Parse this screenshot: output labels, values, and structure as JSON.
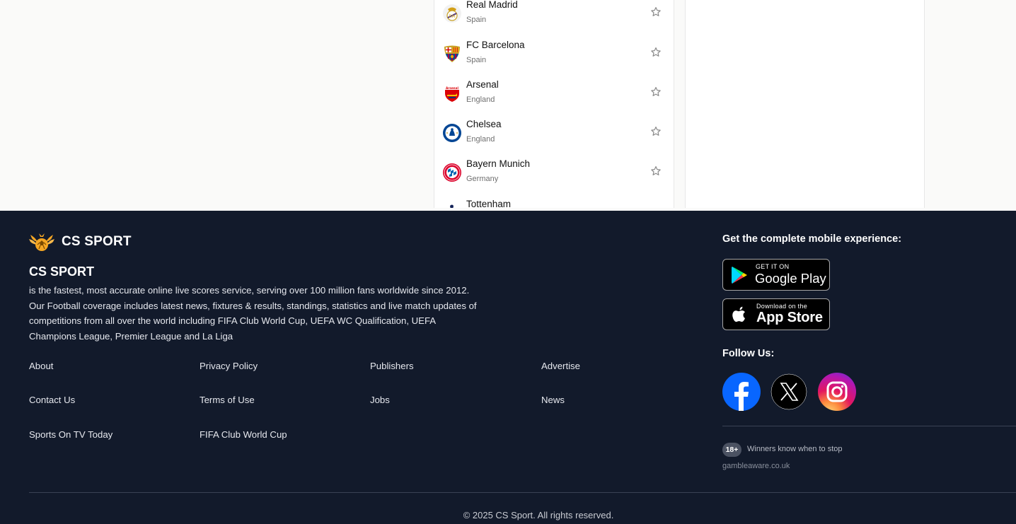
{
  "teams": [
    {
      "name": "Real Madrid",
      "country": "Spain",
      "crest": "real-madrid-crest"
    },
    {
      "name": "FC Barcelona",
      "country": "Spain",
      "crest": "fc-barcelona-crest"
    },
    {
      "name": "Arsenal",
      "country": "England",
      "crest": "arsenal-crest"
    },
    {
      "name": "Chelsea",
      "country": "England",
      "crest": "chelsea-crest"
    },
    {
      "name": "Bayern Munich",
      "country": "Germany",
      "crest": "bayern-munich-crest"
    },
    {
      "name": "Tottenham",
      "country": "",
      "crest": "tottenham-crest"
    }
  ],
  "favorite_icon": "star-outline-icon",
  "footer": {
    "logo_text": "CS SPORT",
    "brand_heading": "CS SPORT",
    "brand_description": "is the fastest, most accurate online live scores service, serving over 100 million fans worldwide since 2012. Our Football coverage includes latest news, fixtures & results, standings, statistics and live match updates of competitions from all over the world including FIFA Club World Cup, UEFA WC Qualification, UEFA Champions League, Premier League and La Liga",
    "links": {
      "about": "About",
      "privacy_policy": "Privacy Policy",
      "publishers": "Publishers",
      "advertise": "Advertise",
      "contact_us": "Contact Us",
      "terms_of_use": "Terms of Use",
      "jobs": "Jobs",
      "news": "News",
      "sports_on_tv_today": "Sports On TV Today",
      "fifa_club_world_cup": "FIFA Club World Cup"
    },
    "mobile_title": "Get the complete mobile experience:",
    "google_play": {
      "small": "GET IT ON",
      "big": "Google Play"
    },
    "app_store": {
      "small": "Download on the",
      "big": "App Store"
    },
    "follow_title": "Follow Us:",
    "social": [
      "facebook-icon",
      "x-icon",
      "instagram-icon"
    ],
    "age_badge": "18+",
    "age_text": "Winners know when to stop",
    "gamble_aware": "gambleaware.co.uk",
    "copyright": "© 2025 CS Sport. All rights reserved."
  },
  "colors": {
    "footer_bg": "#121a2b",
    "page_bg": "#fafaf9",
    "facebook": "#0866ff"
  }
}
